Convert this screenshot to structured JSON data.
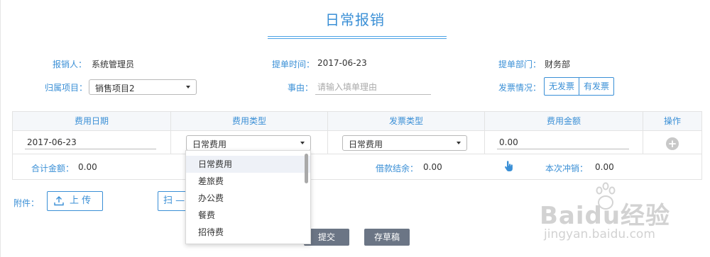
{
  "page": {
    "title": "日常报销"
  },
  "form": {
    "applicant_label": "报销人：",
    "applicant_value": "系统管理员",
    "submit_time_label": "提单时间：",
    "submit_time_value": "2017-06-23",
    "department_label": "提单部门：",
    "department_value": "财务部",
    "project_label": "归属项目：",
    "project_value": "销售项目2",
    "reason_label": "事由：",
    "reason_placeholder": "请输入填单理由",
    "invoice_label": "发票情况：",
    "invoice_options": [
      "无发票",
      "有发票"
    ]
  },
  "table": {
    "headers": [
      "费用日期",
      "费用类型",
      "发票类型",
      "费用金额",
      "操作"
    ],
    "row": {
      "date": "2017-06-23",
      "expense_type": "日常费用",
      "invoice_type": "日常费用",
      "amount": "0.00"
    },
    "summary": {
      "total_label": "合计金额：",
      "total_value": "0.00",
      "loan_label": "借款结余：",
      "loan_value": "0.00",
      "offset_label": "本次冲销：",
      "offset_value": "0.00"
    }
  },
  "attachments": {
    "label": "附件：",
    "upload_label": "上 传",
    "scan_label": "扫 —"
  },
  "dropdown": {
    "options": [
      "日常费用",
      "差旅费",
      "办公费",
      "餐费",
      "招待费"
    ],
    "selected_index": 0
  },
  "actions": {
    "submit_label": "提交",
    "draft_label": "存草稿"
  },
  "watermark": {
    "brand": "Baidu经验",
    "url": "jingyan.baidu.com"
  },
  "colors": {
    "accent": "#3a8fd6",
    "dark_button": "#6b7585",
    "header_bg": "#f5f7fa"
  }
}
